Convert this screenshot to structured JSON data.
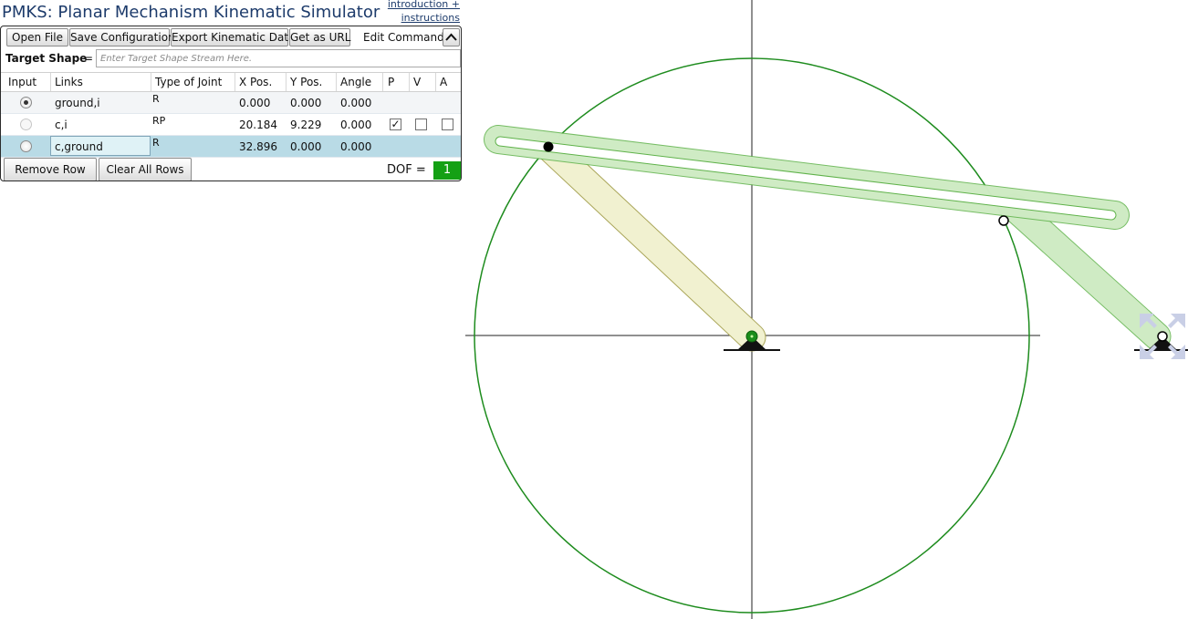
{
  "app": {
    "title": "PMKS: Planar Mechanism Kinematic Simulator",
    "intro_link": "introduction + instructions"
  },
  "toolbar": {
    "open_file": "Open File",
    "save_configuration": "Save Configuration",
    "export_kinematic_data": "Export Kinematic Data",
    "get_as_url": "Get as URL",
    "edit_commands": "Edit Commands"
  },
  "target_shape": {
    "label": "Target Shape",
    "equals": "=",
    "placeholder": "Enter Target Shape Stream Here."
  },
  "table": {
    "headers": {
      "input": "Input",
      "links": "Links",
      "type_of_joint": "Type of Joint",
      "x_pos": "X Pos.",
      "y_pos": "Y Pos.",
      "angle": "Angle",
      "p": "P",
      "v": "V",
      "a": "A"
    },
    "rows": [
      {
        "links": "ground,i",
        "joint_type": "R",
        "x": "0.000",
        "y": "0.000",
        "angle": "0.000",
        "input_selected": true
      },
      {
        "links": "c,i",
        "joint_type": "RP",
        "x": "20.184",
        "y": "9.229",
        "angle": "0.000",
        "input_selected": false,
        "p_checked": true,
        "v_checked": false,
        "a_checked": false
      },
      {
        "links": "c,ground",
        "joint_type": "R",
        "x": "32.896",
        "y": "0.000",
        "angle": "0.000",
        "input_selected": false,
        "selected_row": true
      }
    ]
  },
  "bottom": {
    "remove_row": "Remove Row",
    "clear_all_rows": "Clear All Rows",
    "dof_label": "DOF =",
    "dof_value": "1"
  },
  "colors": {
    "accent_green": "#14a014",
    "slot_fill": "#d9f0cf",
    "slot_stroke": "#5fb24a",
    "crank_fill": "#f1f1d0",
    "crank_stroke": "#a9a558",
    "path_circle": "#1e8c1e",
    "selected_row": "#b9dbe6",
    "title_blue": "#1d3b6b"
  },
  "icons": {
    "sort_chevron": "chevron-up-icon",
    "fit_view": "expand-arrows-icon"
  }
}
